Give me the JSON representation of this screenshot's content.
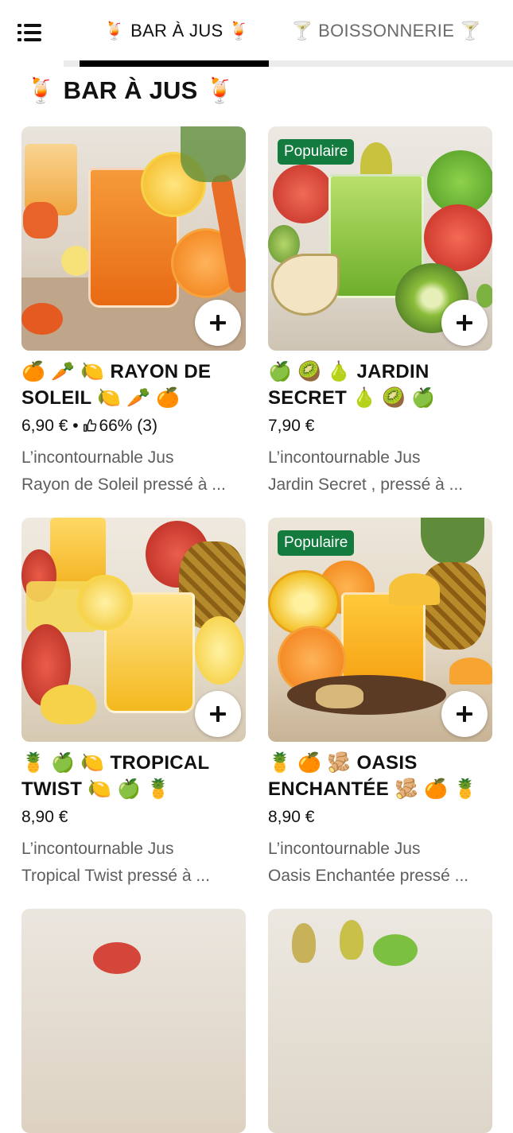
{
  "tabs": [
    {
      "label": "🍹 BAR À JUS 🍹",
      "active": true
    },
    {
      "label": "🍸 BOISSONNERIE 🍸",
      "active": false
    }
  ],
  "section_title": "🍹 BAR À JUS 🍹",
  "products": [
    {
      "title": "🍊 🥕 🍋 RAYON DE SOLEIL 🍋 🥕 🍊",
      "price": "6,90 €",
      "rating_sep": "•",
      "rating": "66% (3)",
      "badge": "",
      "desc_line1": "L’incontournable Jus",
      "desc_line2": "Rayon de Soleil  pressé à ..."
    },
    {
      "title": "🍏 🥝 🍐 JARDIN SECRET 🍐 🥝 🍏",
      "price": "7,90 €",
      "badge": "Populaire",
      "desc_line1": "L’incontournable Jus",
      "desc_line2": "Jardin Secret , pressé à ..."
    },
    {
      "title": "🍍 🍏 🍋 TROPICAL TWIST 🍋 🍏 🍍",
      "price": "8,90 €",
      "badge": "",
      "desc_line1": "L’incontournable Jus",
      "desc_line2": "Tropical Twist pressé à ..."
    },
    {
      "title": "🍍 🍊 🫚 OASIS ENCHANTÉE 🫚 🍊 🍍",
      "price": "8,90 €",
      "badge": "Populaire",
      "desc_line1": "L’incontournable Jus",
      "desc_line2": "Oasis Enchantée  pressé ..."
    }
  ],
  "icons": {
    "menu": "menu-icon",
    "add": "plus-icon",
    "thumbs_up": "thumbs-up-icon"
  },
  "colors": {
    "badge": "#137b3e",
    "tab_indicator": "#000000"
  }
}
